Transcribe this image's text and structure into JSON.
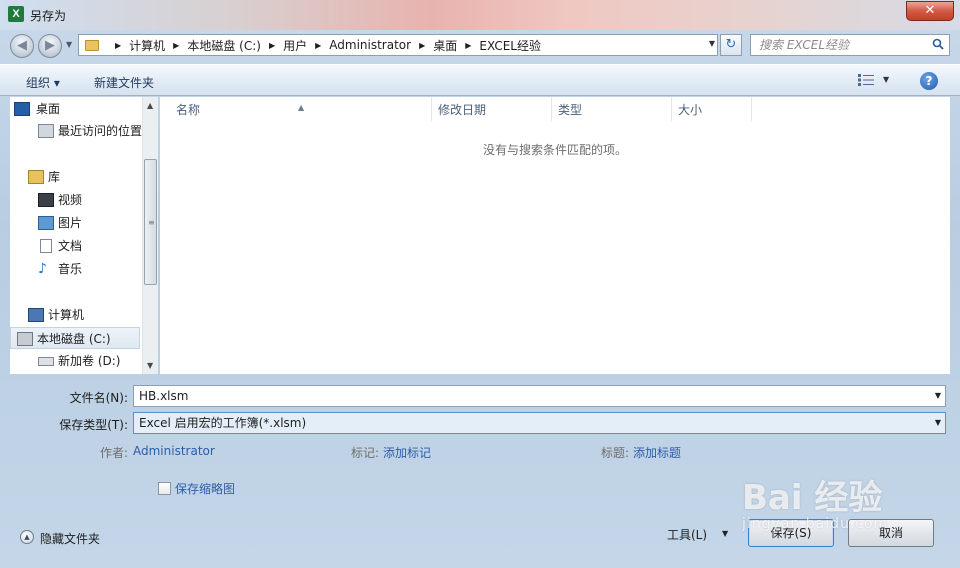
{
  "window": {
    "title": "另存为",
    "app_icon_letter": "X",
    "close_glyph": "✕"
  },
  "breadcrumbs": [
    "计算机",
    "本地磁盘 (C:)",
    "用户",
    "Administrator",
    "桌面",
    "EXCEL经验"
  ],
  "search": {
    "placeholder": "搜索 EXCEL经验"
  },
  "toolbar": {
    "organize": "组织 ▾",
    "new_folder": "新建文件夹",
    "help": "?"
  },
  "nav": {
    "desktop": "桌面",
    "recent": "最近访问的位置",
    "libraries": "库",
    "videos": "视频",
    "pictures": "图片",
    "documents": "文档",
    "music": "音乐",
    "computer": "计算机",
    "drive_c": "本地磁盘 (C:)",
    "drive_d": "新加卷 (D:)"
  },
  "columns": {
    "name": "名称",
    "modified": "修改日期",
    "type": "类型",
    "size": "大小"
  },
  "empty_message": "没有与搜索条件匹配的项。",
  "form": {
    "filename_label": "文件名(N):",
    "filename_value": "HB.xlsm",
    "filetype_label": "保存类型(T):",
    "filetype_value": "Excel 启用宏的工作簿(*.xlsm)",
    "author_label": "作者:",
    "author_value": "Administrator",
    "tags_label": "标记:",
    "tags_value": "添加标记",
    "title_label": "标题:",
    "title_value": "添加标题",
    "thumbnail_label": "保存缩略图"
  },
  "footer": {
    "hide_folders": "隐藏文件夹",
    "tools": "工具(L)",
    "save": "保存(S)",
    "cancel": "取消"
  },
  "watermark": {
    "brand": "Bai 经验",
    "url": "jingyan.baidu.com"
  },
  "colors": {
    "accent": "#2d5ca8",
    "close": "#c53e27",
    "selection": "#dfe8f2"
  }
}
